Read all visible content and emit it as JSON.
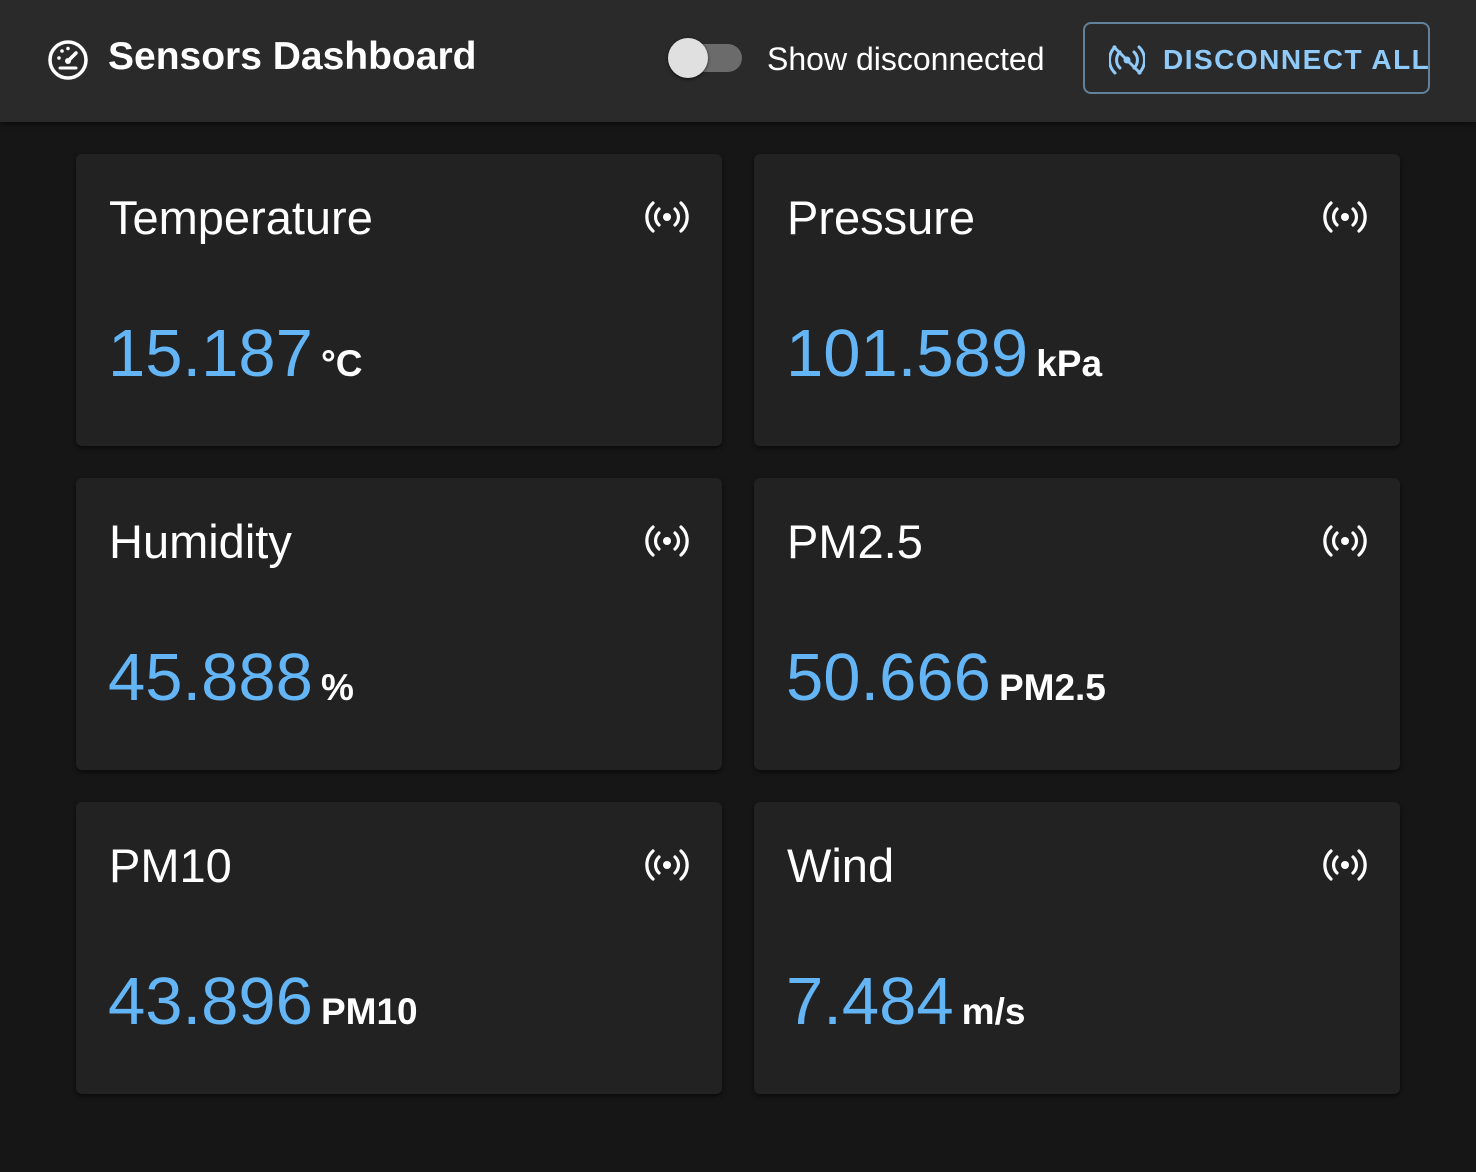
{
  "appbar": {
    "title": "Sensors Dashboard",
    "icon": "speedometer-icon",
    "toggle_label": "Show disconnected",
    "toggle_on": false,
    "disconnect_label": "DISCONNECT ALL",
    "disconnect_icon": "sensors-off-icon"
  },
  "colors": {
    "accent": "#64b5f6",
    "button_text": "#90caf9",
    "appbar_bg": "#2a2a2a",
    "page_bg": "#161616",
    "card_bg": "#222222"
  },
  "sensors": [
    {
      "name": "Temperature",
      "value": "15.187",
      "unit": "°C",
      "icon": "sensors-icon"
    },
    {
      "name": "Pressure",
      "value": "101.589",
      "unit": "kPa",
      "icon": "sensors-icon"
    },
    {
      "name": "Humidity",
      "value": "45.888",
      "unit": "%",
      "icon": "sensors-icon"
    },
    {
      "name": "PM2.5",
      "value": "50.666",
      "unit": "PM2.5",
      "icon": "sensors-icon"
    },
    {
      "name": "PM10",
      "value": "43.896",
      "unit": "PM10",
      "icon": "sensors-icon"
    },
    {
      "name": "Wind",
      "value": "7.484",
      "unit": "m/s",
      "icon": "sensors-icon"
    }
  ]
}
